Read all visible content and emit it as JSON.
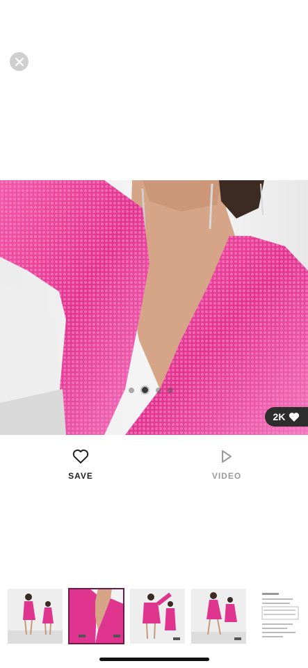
{
  "header": {
    "close_icon": "close-icon"
  },
  "product_gallery": {
    "image_index": 2,
    "image_count": 4,
    "likes_count": "2K",
    "accent_color": "#e0358f"
  },
  "actions": {
    "save_label": "SAVE",
    "video_label": "VIDEO"
  },
  "thumbnails": {
    "selected_index": 1,
    "count": 5
  }
}
